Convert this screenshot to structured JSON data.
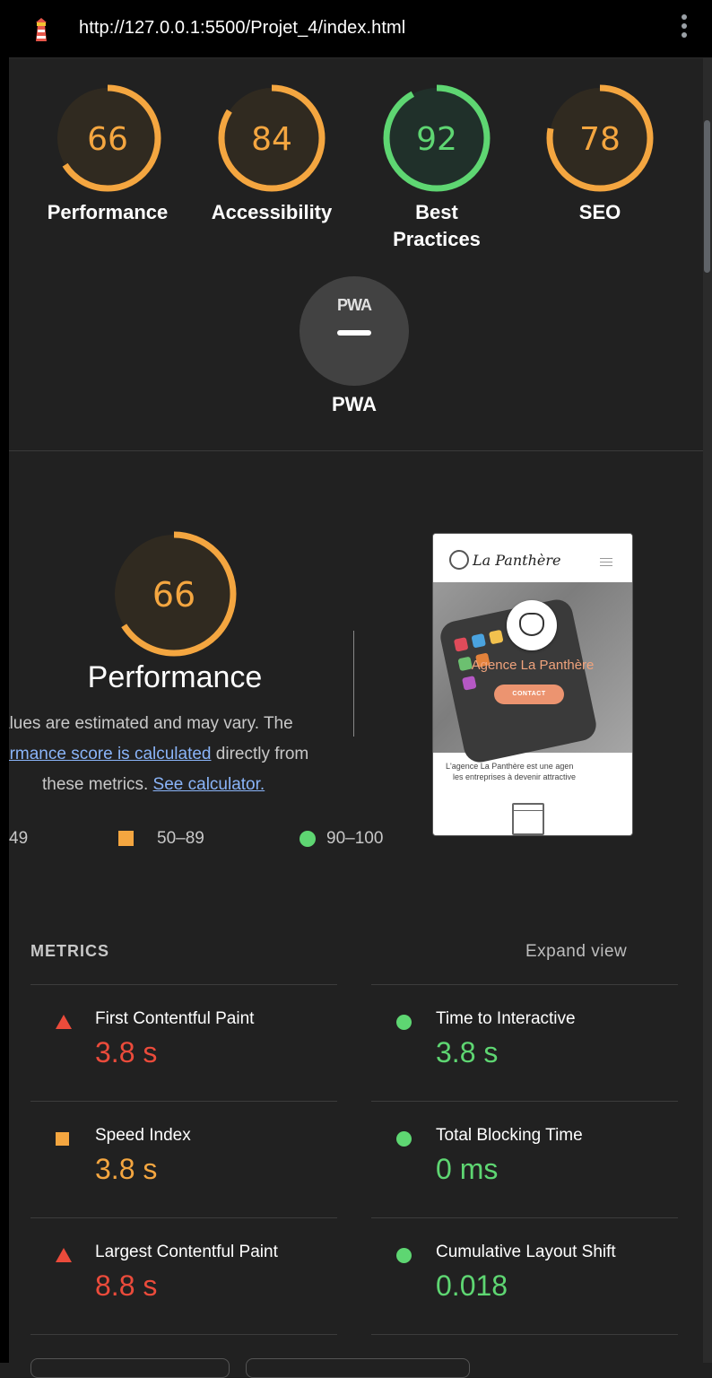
{
  "topbar": {
    "url": "http://127.0.0.1:5500/Projet_4/index.html",
    "icons": [
      "lighthouse-icon",
      "more-vert-icon"
    ]
  },
  "colors": {
    "pass": "#5ed672",
    "average": "#f4a640",
    "fail": "#eb4b3b",
    "background": "#212121"
  },
  "categories": [
    {
      "label": "Performance",
      "score": "66",
      "fraction": 0.66,
      "status": "average"
    },
    {
      "label": "Accessibility",
      "score": "84",
      "fraction": 0.84,
      "status": "average"
    },
    {
      "label": "Best Practices",
      "label_line1": "Best",
      "label_line2": "Practices",
      "score": "92",
      "fraction": 0.92,
      "status": "pass"
    },
    {
      "label": "SEO",
      "score": "78",
      "fraction": 0.78,
      "status": "average"
    }
  ],
  "pwa": {
    "badge": "PWA",
    "label": "PWA"
  },
  "performance": {
    "score": "66",
    "fraction": 0.66,
    "title": "Performance",
    "desc_line1": "alues are estimated and may vary. The",
    "desc_link1": "ormance score is calculated",
    "desc_line2_rest": " directly from",
    "desc_line3": "these metrics. ",
    "desc_link2": "See calculator.",
    "legend": {
      "fail": "49",
      "average": "50–89",
      "pass": "90–100"
    }
  },
  "thumbnail": {
    "brand": "La Panthère",
    "hero_title": "Agence La Panthère",
    "cta": "CONTACT",
    "text_line1": "L'agence La Panthère est une agen",
    "text_line2": "les entreprises à devenir attractive"
  },
  "metrics": {
    "title": "METRICS",
    "expand": "Expand view",
    "items": [
      {
        "label": "First Contentful Paint",
        "value": "3.8 s",
        "status": "fail"
      },
      {
        "label": "Time to Interactive",
        "value": "3.8 s",
        "status": "pass"
      },
      {
        "label": "Speed Index",
        "value": "3.8 s",
        "status": "average"
      },
      {
        "label": "Total Blocking Time",
        "value": "0 ms",
        "status": "pass"
      },
      {
        "label": "Largest Contentful Paint",
        "value": "8.8 s",
        "status": "fail"
      },
      {
        "label": "Cumulative Layout Shift",
        "value": "0.018",
        "status": "pass"
      }
    ]
  }
}
